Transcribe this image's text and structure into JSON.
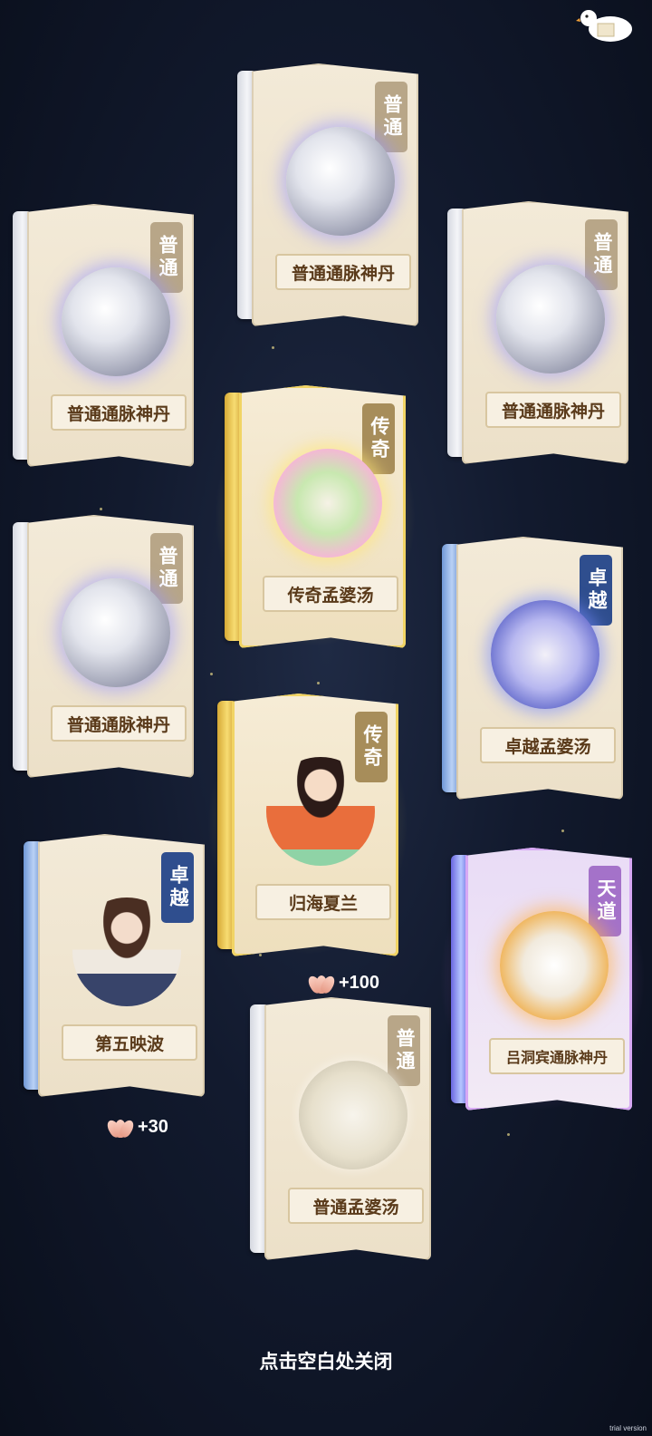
{
  "cards": [
    {
      "id": "c1",
      "rarity": "普通",
      "name": "普通通脉神丹",
      "art": "silver-pill-orb"
    },
    {
      "id": "c2",
      "rarity": "普通",
      "name": "普通通脉神丹",
      "art": "silver-pill-orb"
    },
    {
      "id": "c3",
      "rarity": "普通",
      "name": "普通通脉神丹",
      "art": "silver-pill-orb"
    },
    {
      "id": "c4",
      "rarity": "传奇",
      "name": "传奇孟婆汤",
      "art": "legend-soup-orb"
    },
    {
      "id": "c5",
      "rarity": "普通",
      "name": "普通通脉神丹",
      "art": "silver-pill-orb"
    },
    {
      "id": "c6",
      "rarity": "卓越",
      "name": "卓越孟婆汤",
      "art": "superb-soup-orb"
    },
    {
      "id": "c7",
      "rarity": "传奇",
      "name": "归海夏兰",
      "art": "character-girl"
    },
    {
      "id": "c8",
      "rarity": "卓越",
      "name": "第五映波",
      "art": "character-boy"
    },
    {
      "id": "c9",
      "rarity": "天道",
      "name": "吕洞宾通脉神丹",
      "art": "heaven-pill-orb"
    },
    {
      "id": "c10",
      "rarity": "普通",
      "name": "普通孟婆汤",
      "art": "common-soup-orb"
    }
  ],
  "rewards": [
    {
      "amount": "+100",
      "icon": "lotus-icon"
    },
    {
      "amount": "+30",
      "icon": "lotus-icon"
    }
  ],
  "close_hint": "点击空白处关闭",
  "watermark": "trial version",
  "colors": {
    "common": "#b8a688",
    "legend": "#a78d5a",
    "superb": "#2f4e8e",
    "heaven": "#a472c9",
    "name_text": "#5a3a1a"
  }
}
